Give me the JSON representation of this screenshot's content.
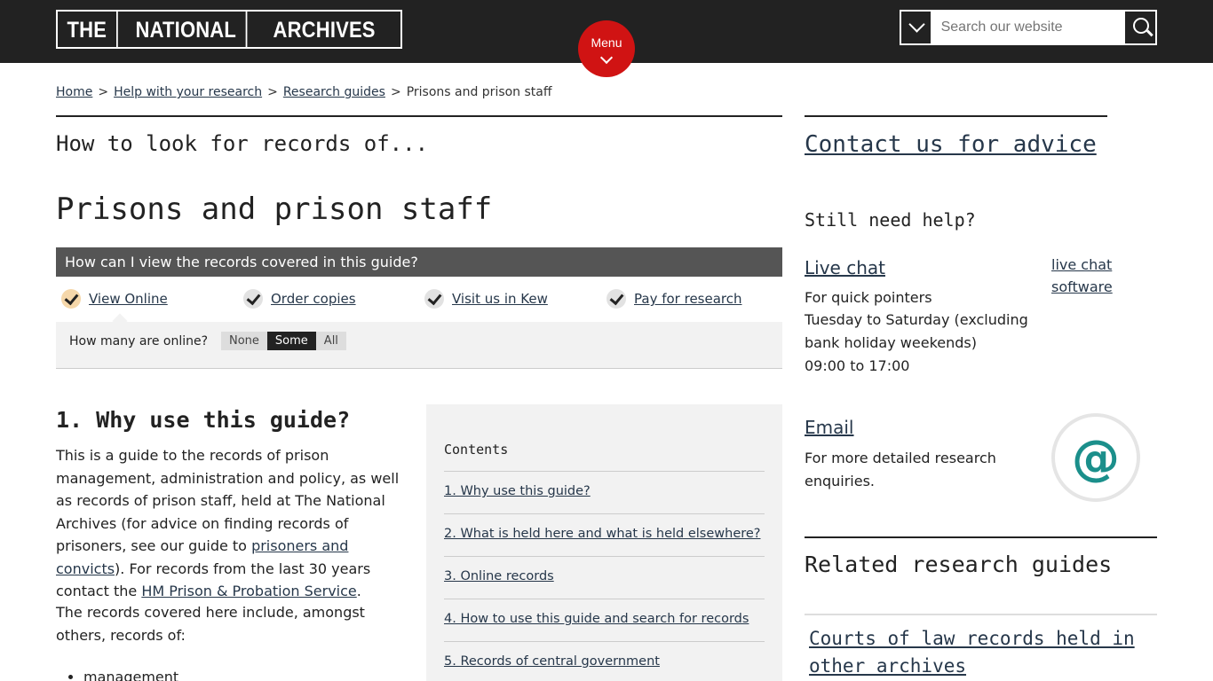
{
  "header": {
    "logo": [
      "THE",
      "NATIONAL",
      "ARCHIVES"
    ],
    "menu_label": "Menu",
    "search_placeholder": "Search our website"
  },
  "breadcrumb": {
    "items": [
      "Home",
      "Help with your research",
      "Research guides"
    ],
    "current": "Prisons and prison staff",
    "separator": ">"
  },
  "main": {
    "eyebrow": "How to look for records of...",
    "title": "Prisons and prison staff",
    "view_bar": "How can I view the records covered in this guide?",
    "options": [
      "View Online",
      "Order copies",
      "Visit us in Kew",
      "Pay for research"
    ],
    "online_label": "How many are online?",
    "toggle": [
      "None",
      "Some",
      "All"
    ],
    "toggle_selected": "Some",
    "section1_title": "1. Why use this guide?",
    "p1_a": "This is a guide to the records of prison management, administration and policy, as well as records of prison staff, held at The National Archives (for advice on finding records of prisoners, see our guide to ",
    "p1_link1": "prisoners and convicts",
    "p1_b": "). For records from the last 30 years contact the ",
    "p1_link2": "HM Prison & Probation Service",
    "p1_c": ".",
    "p2": "The records covered here include, amongst others, records of:",
    "list": [
      "management"
    ]
  },
  "contents": {
    "heading": "Contents",
    "items": [
      "1. Why use this guide?",
      "2. What is held here and what is held elsewhere?",
      "3. Online records",
      "4. How to use this guide and search for records",
      "5. Records of central government"
    ]
  },
  "sidebar": {
    "contact": "Contact us for advice",
    "still_help": "Still need help?",
    "live_chat": "Live chat",
    "live_chat_software": "live chat software",
    "chat_lines": [
      "For quick pointers",
      "Tuesday to Saturday (excluding bank holiday weekends)",
      "09:00 to 17:00"
    ],
    "email": "Email",
    "email_text": "For more detailed research enquiries.",
    "at_symbol": "@",
    "related_title": "Related research guides",
    "related_links": [
      "Courts of law records held in other archives"
    ]
  },
  "colors": {
    "header_bg": "#222222",
    "menu_red": "#d01313",
    "accent_teal": "#1b8f8b"
  }
}
